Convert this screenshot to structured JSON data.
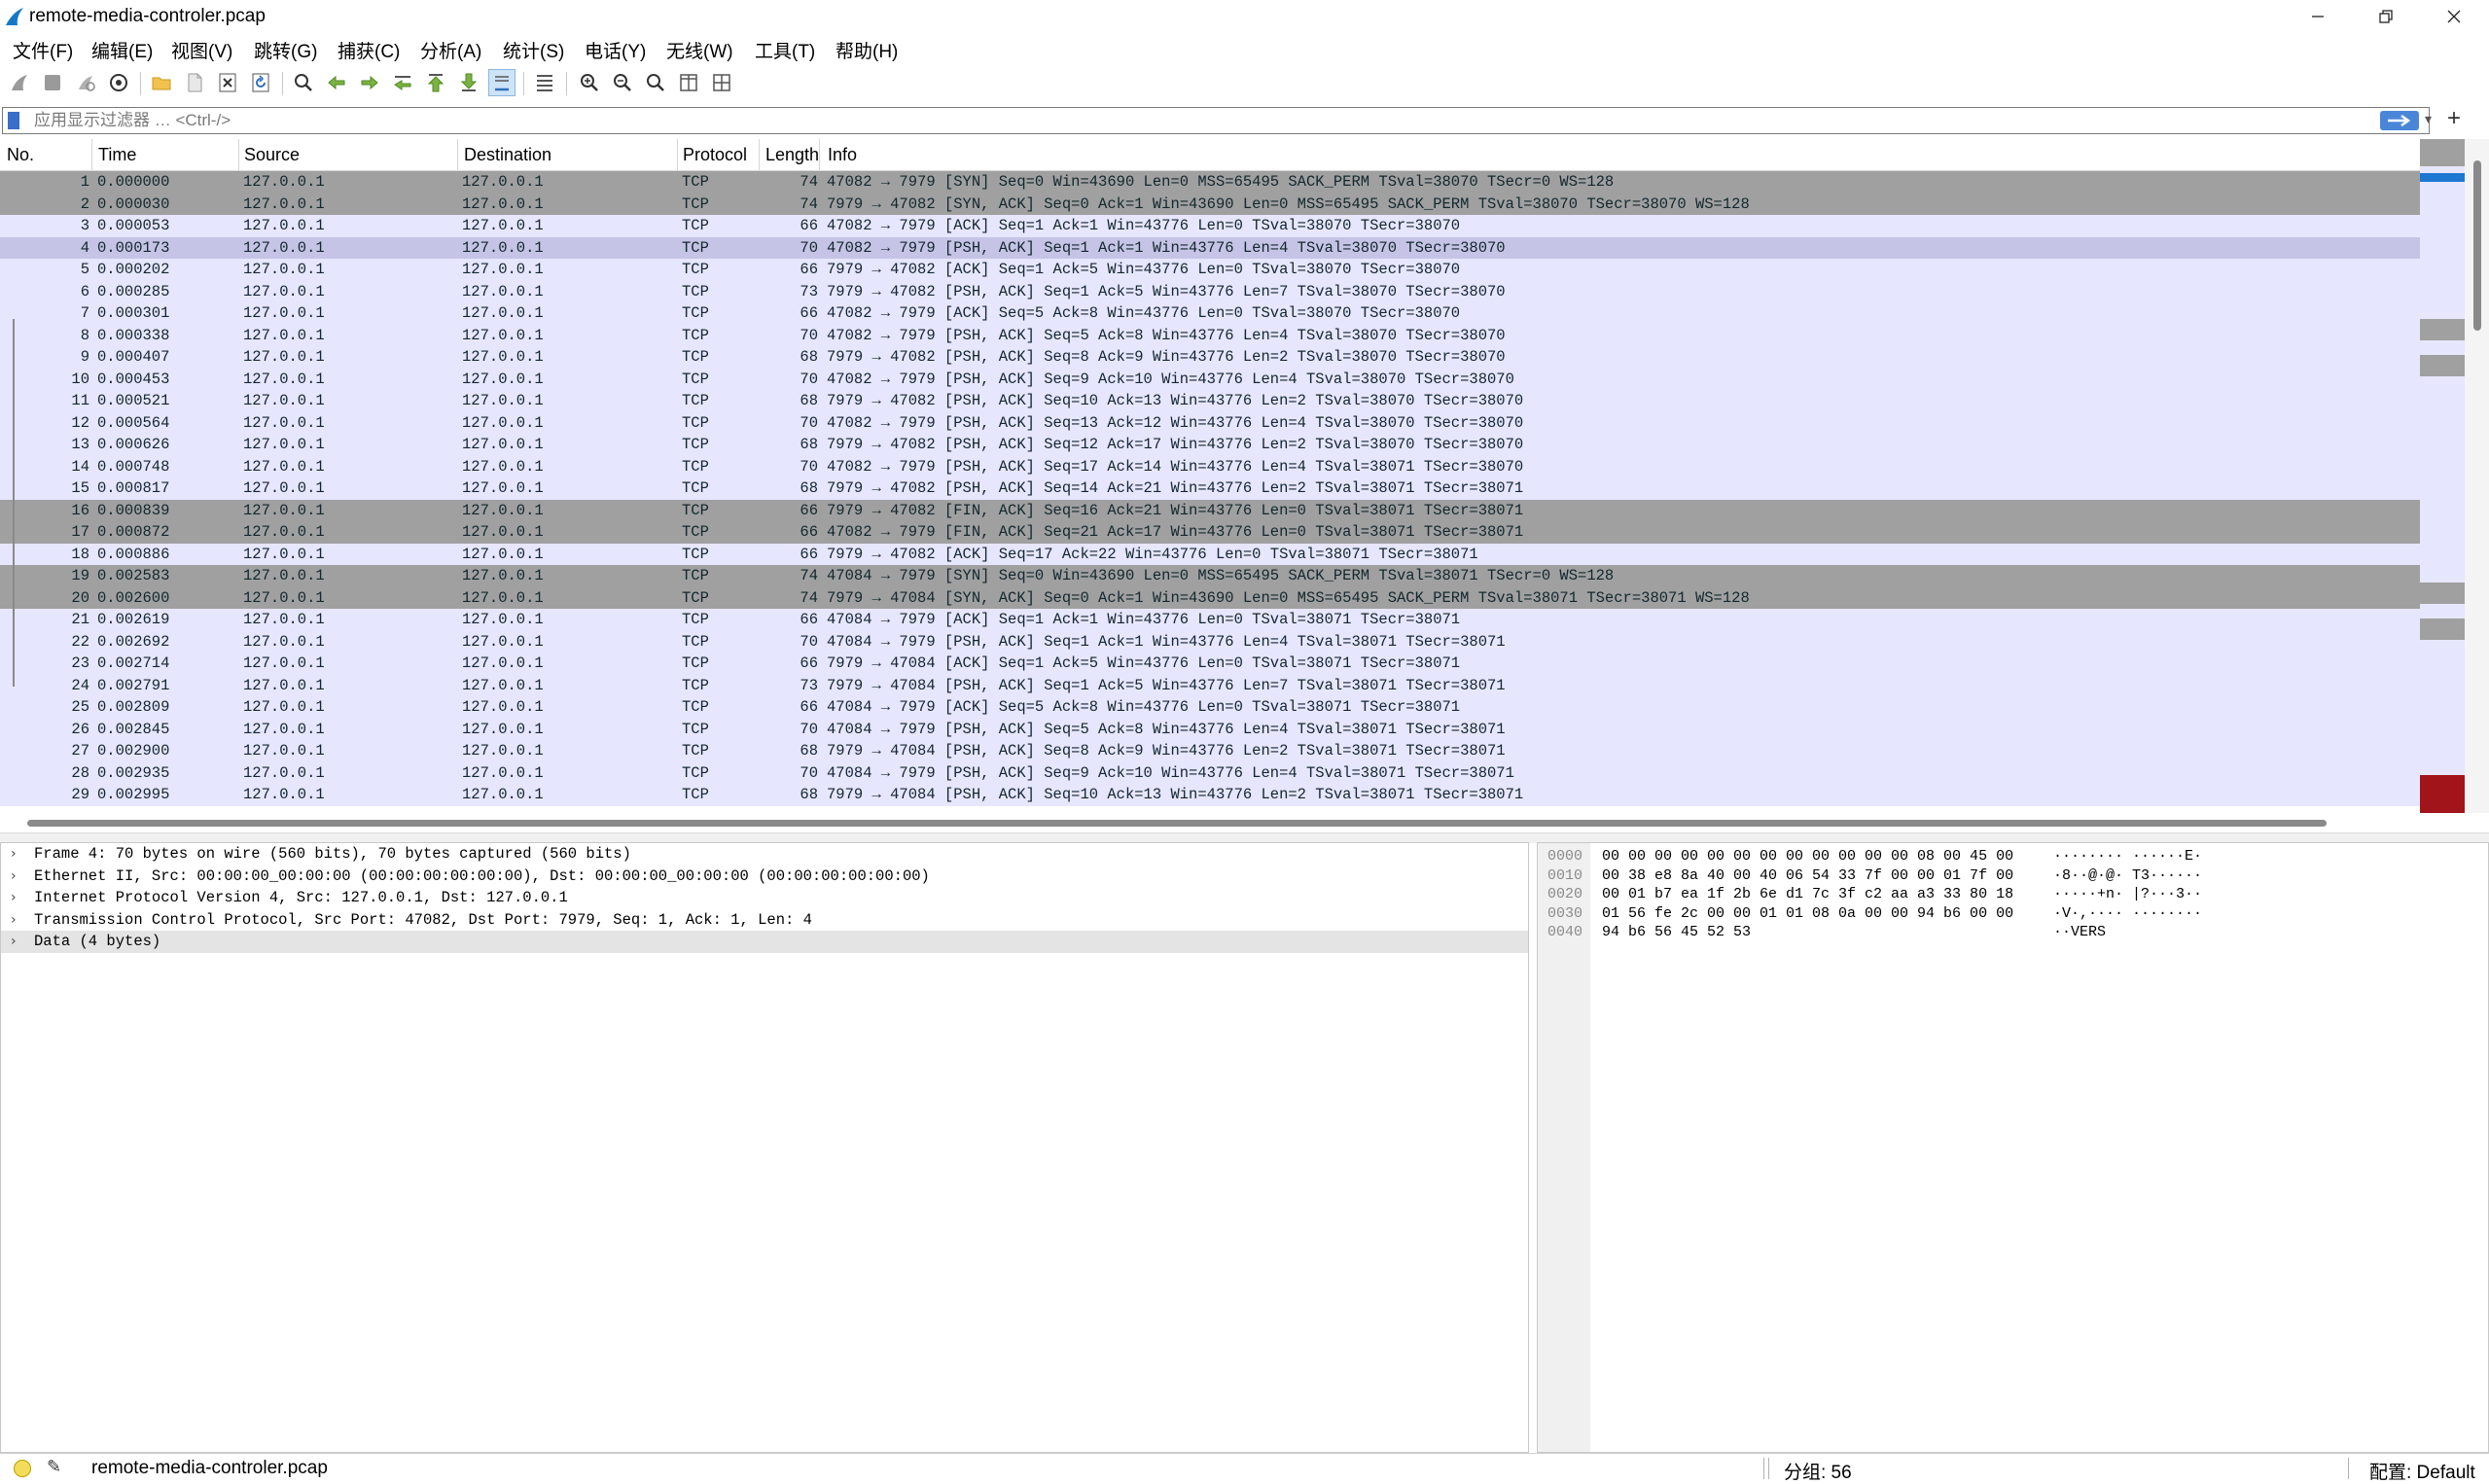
{
  "window": {
    "title": "remote-media-controler.pcap",
    "icon": "wireshark-fin-icon",
    "controls": [
      "minimize",
      "restore",
      "close"
    ]
  },
  "menu": [
    "文件(F)",
    "编辑(E)",
    "视图(V)",
    "跳转(G)",
    "捕获(C)",
    "分析(A)",
    "统计(S)",
    "电话(Y)",
    "无线(W)",
    "工具(T)",
    "帮助(H)"
  ],
  "toolbar_icons": [
    "start-capture-icon",
    "stop-capture-icon",
    "restart-capture-icon",
    "capture-options-icon",
    "open-file-icon",
    "save-file-icon",
    "close-file-icon",
    "reload-file-icon",
    "find-packet-icon",
    "go-back-icon",
    "go-forward-icon",
    "go-to-packet-icon",
    "go-first-icon",
    "go-last-icon",
    "autoscroll-icon",
    "colorize-icon",
    "zoom-in-icon",
    "zoom-out-icon",
    "zoom-normal-icon",
    "resize-columns-icon",
    "layout-icon"
  ],
  "filter": {
    "placeholder": "应用显示过滤器 … <Ctrl-/>",
    "value": ""
  },
  "packet_list": {
    "columns": [
      "No.",
      "Time",
      "Source",
      "Destination",
      "Protocol",
      "Length",
      "Info"
    ],
    "rows": [
      {
        "no": "1",
        "time": "0.000000",
        "src": "127.0.0.1",
        "dst": "127.0.0.1",
        "proto": "TCP",
        "len": "74",
        "info": "47082 → 7979 [SYN] Seq=0 Win=43690 Len=0 MSS=65495 SACK_PERM TSval=38070 TSecr=0 WS=128",
        "style": "dark"
      },
      {
        "no": "2",
        "time": "0.000030",
        "src": "127.0.0.1",
        "dst": "127.0.0.1",
        "proto": "TCP",
        "len": "74",
        "info": "7979 → 47082 [SYN, ACK] Seq=0 Ack=1 Win=43690 Len=0 MSS=65495 SACK_PERM TSval=38070 TSecr=38070 WS=128",
        "style": "dark"
      },
      {
        "no": "3",
        "time": "0.000053",
        "src": "127.0.0.1",
        "dst": "127.0.0.1",
        "proto": "TCP",
        "len": "66",
        "info": "47082 → 7979 [ACK] Seq=1 Ack=1 Win=43776 Len=0 TSval=38070 TSecr=38070",
        "style": "normal"
      },
      {
        "no": "4",
        "time": "0.000173",
        "src": "127.0.0.1",
        "dst": "127.0.0.1",
        "proto": "TCP",
        "len": "70",
        "info": "47082 → 7979 [PSH, ACK] Seq=1 Ack=1 Win=43776 Len=4 TSval=38070 TSecr=38070",
        "style": "selected"
      },
      {
        "no": "5",
        "time": "0.000202",
        "src": "127.0.0.1",
        "dst": "127.0.0.1",
        "proto": "TCP",
        "len": "66",
        "info": "7979 → 47082 [ACK] Seq=1 Ack=5 Win=43776 Len=0 TSval=38070 TSecr=38070",
        "style": "normal"
      },
      {
        "no": "6",
        "time": "0.000285",
        "src": "127.0.0.1",
        "dst": "127.0.0.1",
        "proto": "TCP",
        "len": "73",
        "info": "7979 → 47082 [PSH, ACK] Seq=1 Ack=5 Win=43776 Len=7 TSval=38070 TSecr=38070",
        "style": "normal"
      },
      {
        "no": "7",
        "time": "0.000301",
        "src": "127.0.0.1",
        "dst": "127.0.0.1",
        "proto": "TCP",
        "len": "66",
        "info": "47082 → 7979 [ACK] Seq=5 Ack=8 Win=43776 Len=0 TSval=38070 TSecr=38070",
        "style": "normal"
      },
      {
        "no": "8",
        "time": "0.000338",
        "src": "127.0.0.1",
        "dst": "127.0.0.1",
        "proto": "TCP",
        "len": "70",
        "info": "47082 → 7979 [PSH, ACK] Seq=5 Ack=8 Win=43776 Len=4 TSval=38070 TSecr=38070",
        "style": "normal"
      },
      {
        "no": "9",
        "time": "0.000407",
        "src": "127.0.0.1",
        "dst": "127.0.0.1",
        "proto": "TCP",
        "len": "68",
        "info": "7979 → 47082 [PSH, ACK] Seq=8 Ack=9 Win=43776 Len=2 TSval=38070 TSecr=38070",
        "style": "normal"
      },
      {
        "no": "10",
        "time": "0.000453",
        "src": "127.0.0.1",
        "dst": "127.0.0.1",
        "proto": "TCP",
        "len": "70",
        "info": "47082 → 7979 [PSH, ACK] Seq=9 Ack=10 Win=43776 Len=4 TSval=38070 TSecr=38070",
        "style": "normal"
      },
      {
        "no": "11",
        "time": "0.000521",
        "src": "127.0.0.1",
        "dst": "127.0.0.1",
        "proto": "TCP",
        "len": "68",
        "info": "7979 → 47082 [PSH, ACK] Seq=10 Ack=13 Win=43776 Len=2 TSval=38070 TSecr=38070",
        "style": "normal"
      },
      {
        "no": "12",
        "time": "0.000564",
        "src": "127.0.0.1",
        "dst": "127.0.0.1",
        "proto": "TCP",
        "len": "70",
        "info": "47082 → 7979 [PSH, ACK] Seq=13 Ack=12 Win=43776 Len=4 TSval=38070 TSecr=38070",
        "style": "normal"
      },
      {
        "no": "13",
        "time": "0.000626",
        "src": "127.0.0.1",
        "dst": "127.0.0.1",
        "proto": "TCP",
        "len": "68",
        "info": "7979 → 47082 [PSH, ACK] Seq=12 Ack=17 Win=43776 Len=2 TSval=38070 TSecr=38070",
        "style": "normal"
      },
      {
        "no": "14",
        "time": "0.000748",
        "src": "127.0.0.1",
        "dst": "127.0.0.1",
        "proto": "TCP",
        "len": "70",
        "info": "47082 → 7979 [PSH, ACK] Seq=17 Ack=14 Win=43776 Len=4 TSval=38071 TSecr=38070",
        "style": "normal"
      },
      {
        "no": "15",
        "time": "0.000817",
        "src": "127.0.0.1",
        "dst": "127.0.0.1",
        "proto": "TCP",
        "len": "68",
        "info": "7979 → 47082 [PSH, ACK] Seq=14 Ack=21 Win=43776 Len=2 TSval=38071 TSecr=38071",
        "style": "normal"
      },
      {
        "no": "16",
        "time": "0.000839",
        "src": "127.0.0.1",
        "dst": "127.0.0.1",
        "proto": "TCP",
        "len": "66",
        "info": "7979 → 47082 [FIN, ACK] Seq=16 Ack=21 Win=43776 Len=0 TSval=38071 TSecr=38071",
        "style": "dark"
      },
      {
        "no": "17",
        "time": "0.000872",
        "src": "127.0.0.1",
        "dst": "127.0.0.1",
        "proto": "TCP",
        "len": "66",
        "info": "47082 → 7979 [FIN, ACK] Seq=21 Ack=17 Win=43776 Len=0 TSval=38071 TSecr=38071",
        "style": "dark"
      },
      {
        "no": "18",
        "time": "0.000886",
        "src": "127.0.0.1",
        "dst": "127.0.0.1",
        "proto": "TCP",
        "len": "66",
        "info": "7979 → 47082 [ACK] Seq=17 Ack=22 Win=43776 Len=0 TSval=38071 TSecr=38071",
        "style": "normal"
      },
      {
        "no": "19",
        "time": "0.002583",
        "src": "127.0.0.1",
        "dst": "127.0.0.1",
        "proto": "TCP",
        "len": "74",
        "info": "47084 → 7979 [SYN] Seq=0 Win=43690 Len=0 MSS=65495 SACK_PERM TSval=38071 TSecr=0 WS=128",
        "style": "dark"
      },
      {
        "no": "20",
        "time": "0.002600",
        "src": "127.0.0.1",
        "dst": "127.0.0.1",
        "proto": "TCP",
        "len": "74",
        "info": "7979 → 47084 [SYN, ACK] Seq=0 Ack=1 Win=43690 Len=0 MSS=65495 SACK_PERM TSval=38071 TSecr=38071 WS=128",
        "style": "dark"
      },
      {
        "no": "21",
        "time": "0.002619",
        "src": "127.0.0.1",
        "dst": "127.0.0.1",
        "proto": "TCP",
        "len": "66",
        "info": "47084 → 7979 [ACK] Seq=1 Ack=1 Win=43776 Len=0 TSval=38071 TSecr=38071",
        "style": "normal"
      },
      {
        "no": "22",
        "time": "0.002692",
        "src": "127.0.0.1",
        "dst": "127.0.0.1",
        "proto": "TCP",
        "len": "70",
        "info": "47084 → 7979 [PSH, ACK] Seq=1 Ack=1 Win=43776 Len=4 TSval=38071 TSecr=38071",
        "style": "normal"
      },
      {
        "no": "23",
        "time": "0.002714",
        "src": "127.0.0.1",
        "dst": "127.0.0.1",
        "proto": "TCP",
        "len": "66",
        "info": "7979 → 47084 [ACK] Seq=1 Ack=5 Win=43776 Len=0 TSval=38071 TSecr=38071",
        "style": "normal"
      },
      {
        "no": "24",
        "time": "0.002791",
        "src": "127.0.0.1",
        "dst": "127.0.0.1",
        "proto": "TCP",
        "len": "73",
        "info": "7979 → 47084 [PSH, ACK] Seq=1 Ack=5 Win=43776 Len=7 TSval=38071 TSecr=38071",
        "style": "normal"
      },
      {
        "no": "25",
        "time": "0.002809",
        "src": "127.0.0.1",
        "dst": "127.0.0.1",
        "proto": "TCP",
        "len": "66",
        "info": "47084 → 7979 [ACK] Seq=5 Ack=8 Win=43776 Len=0 TSval=38071 TSecr=38071",
        "style": "normal"
      },
      {
        "no": "26",
        "time": "0.002845",
        "src": "127.0.0.1",
        "dst": "127.0.0.1",
        "proto": "TCP",
        "len": "70",
        "info": "47084 → 7979 [PSH, ACK] Seq=5 Ack=8 Win=43776 Len=4 TSval=38071 TSecr=38071",
        "style": "normal"
      },
      {
        "no": "27",
        "time": "0.002900",
        "src": "127.0.0.1",
        "dst": "127.0.0.1",
        "proto": "TCP",
        "len": "68",
        "info": "7979 → 47084 [PSH, ACK] Seq=8 Ack=9 Win=43776 Len=2 TSval=38071 TSecr=38071",
        "style": "normal"
      },
      {
        "no": "28",
        "time": "0.002935",
        "src": "127.0.0.1",
        "dst": "127.0.0.1",
        "proto": "TCP",
        "len": "70",
        "info": "47084 → 7979 [PSH, ACK] Seq=9 Ack=10 Win=43776 Len=4 TSval=38071 TSecr=38071",
        "style": "normal"
      },
      {
        "no": "29",
        "time": "0.002995",
        "src": "127.0.0.1",
        "dst": "127.0.0.1",
        "proto": "TCP",
        "len": "68",
        "info": "7979 → 47084 [PSH, ACK] Seq=10 Ack=13 Win=43776 Len=2 TSval=38071 TSecr=38071",
        "style": "normal"
      }
    ]
  },
  "details": [
    "Frame 4: 70 bytes on wire (560 bits), 70 bytes captured (560 bits)",
    "Ethernet II, Src: 00:00:00_00:00:00 (00:00:00:00:00:00), Dst: 00:00:00_00:00:00 (00:00:00:00:00:00)",
    "Internet Protocol Version 4, Src: 127.0.0.1, Dst: 127.0.0.1",
    "Transmission Control Protocol, Src Port: 47082, Dst Port: 7979, Seq: 1, Ack: 1, Len: 4",
    "Data (4 bytes)"
  ],
  "bytes": [
    {
      "offset": "0000",
      "hex": "00 00 00 00 00 00 00 00  00 00 00 00 08 00 45 00",
      "ascii": "········ ······E·"
    },
    {
      "offset": "0010",
      "hex": "00 38 e8 8a 40 00 40 06  54 33 7f 00 00 01 7f 00",
      "ascii": "·8··@·@· T3······"
    },
    {
      "offset": "0020",
      "hex": "00 01 b7 ea 1f 2b 6e d1  7c 3f c2 aa a3 33 80 18",
      "ascii": "·····+n· |?···3··"
    },
    {
      "offset": "0030",
      "hex": "01 56 fe 2c 00 00 01 01  08 0a 00 00 94 b6 00 00",
      "ascii": "·V·,···· ········"
    },
    {
      "offset": "0040",
      "hex": "94 b6 56 45 52 53",
      "ascii": "··VERS"
    }
  ],
  "status": {
    "file": "remote-media-controler.pcap",
    "packet_count": "分组: 56",
    "profile": "配置: Default"
  },
  "colors": {
    "row_normal": "#e7e6ff",
    "row_dark": "#a0a0a0",
    "row_selected": "#c6c4e6",
    "accent": "#3a6ec8"
  }
}
